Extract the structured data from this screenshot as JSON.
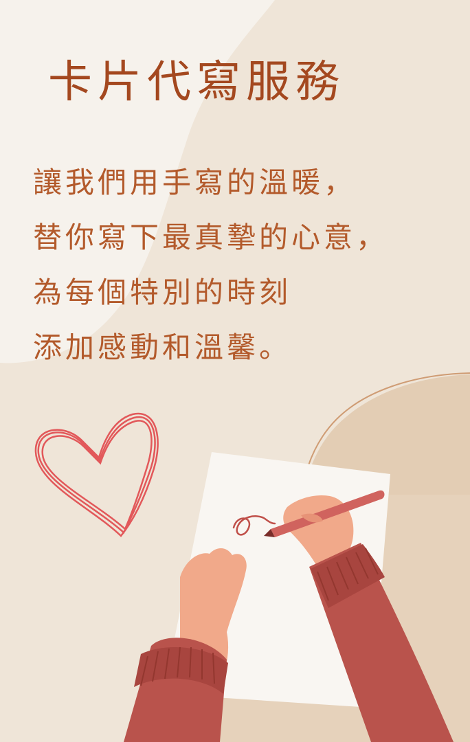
{
  "title": "卡片代寫服務",
  "body_lines": [
    "讓我們用手寫的溫暖，",
    "替你寫下最真摯的心意，",
    "為每個特別的時刻",
    "添加感動和溫馨。"
  ],
  "colors": {
    "background": "#efe5d8",
    "title_text": "#a4481f",
    "body_text": "#b35a2b",
    "heart": "#e2585a",
    "sleeve": "#b9534c",
    "skin": "#f1a98a"
  },
  "illustration": {
    "heart_icon": "heart-icon",
    "letter": "paper-sheet",
    "pen": "pen-icon",
    "hands": "hands-writing-illustration"
  }
}
